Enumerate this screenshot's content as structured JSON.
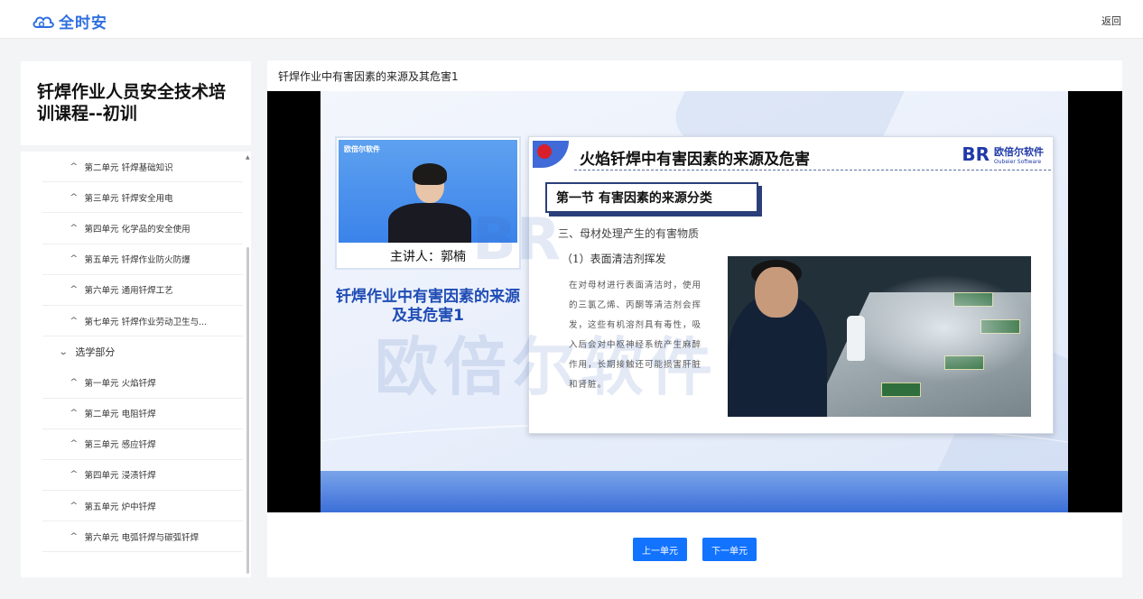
{
  "header": {
    "brand": "全时安",
    "back_label": "返回"
  },
  "sidebar": {
    "course_title": "钎焊作业人员安全技术培训课程--初训",
    "items": [
      {
        "type": "unit",
        "label": "第二单元 钎焊基础知识"
      },
      {
        "type": "unit",
        "label": "第三单元 钎焊安全用电"
      },
      {
        "type": "unit",
        "label": "第四单元 化学品的安全使用"
      },
      {
        "type": "unit",
        "label": "第五单元 钎焊作业防火防爆"
      },
      {
        "type": "unit",
        "label": "第六单元 通用钎焊工艺"
      },
      {
        "type": "unit",
        "label": "第七单元 钎焊作业劳动卫生与..."
      },
      {
        "type": "group",
        "label": "选学部分"
      },
      {
        "type": "unit",
        "label": "第一单元 火焰钎焊"
      },
      {
        "type": "unit",
        "label": "第二单元 电阻钎焊"
      },
      {
        "type": "unit",
        "label": "第三单元 感应钎焊"
      },
      {
        "type": "unit",
        "label": "第四单元 浸渍钎焊"
      },
      {
        "type": "unit",
        "label": "第五单元 炉中钎焊"
      },
      {
        "type": "unit",
        "label": "第六单元 电弧钎焊与碳弧钎焊"
      }
    ]
  },
  "main": {
    "lesson_title": "钎焊作业中有害因素的来源及其危害1",
    "slide": {
      "teacher_logo": "欧倍尔软件",
      "teacher_name": "主讲人：郭楠",
      "big_title": "钎焊作业中有害因素的来源及其危害1",
      "heading": "火焰钎焊中有害因素的来源及危害",
      "logo_mark": "BR",
      "logo_name": "欧倍尔软件",
      "logo_sub": "Oubeier Software",
      "section": "第一节 有害因素的来源分类",
      "subheading": "三、母材处理产生的有害物质",
      "subsub": "（1）表面清洁剂挥发",
      "body": "在对母材进行表面清洁时，使用的三氯乙烯、丙酮等清洁剂会挥发，这些有机溶剂具有毒性，吸入后会对中枢神经系统产生麻醉作用，长期接触还可能损害肝脏和肾脏。",
      "watermark": "欧倍尔软件",
      "watermark_mark": "BR"
    },
    "prev_label": "上一单元",
    "next_label": "下一单元"
  },
  "colors": {
    "brand_blue": "#2f6fe0",
    "button_blue": "#1273ff",
    "slide_title_blue": "#1f4cb5"
  }
}
